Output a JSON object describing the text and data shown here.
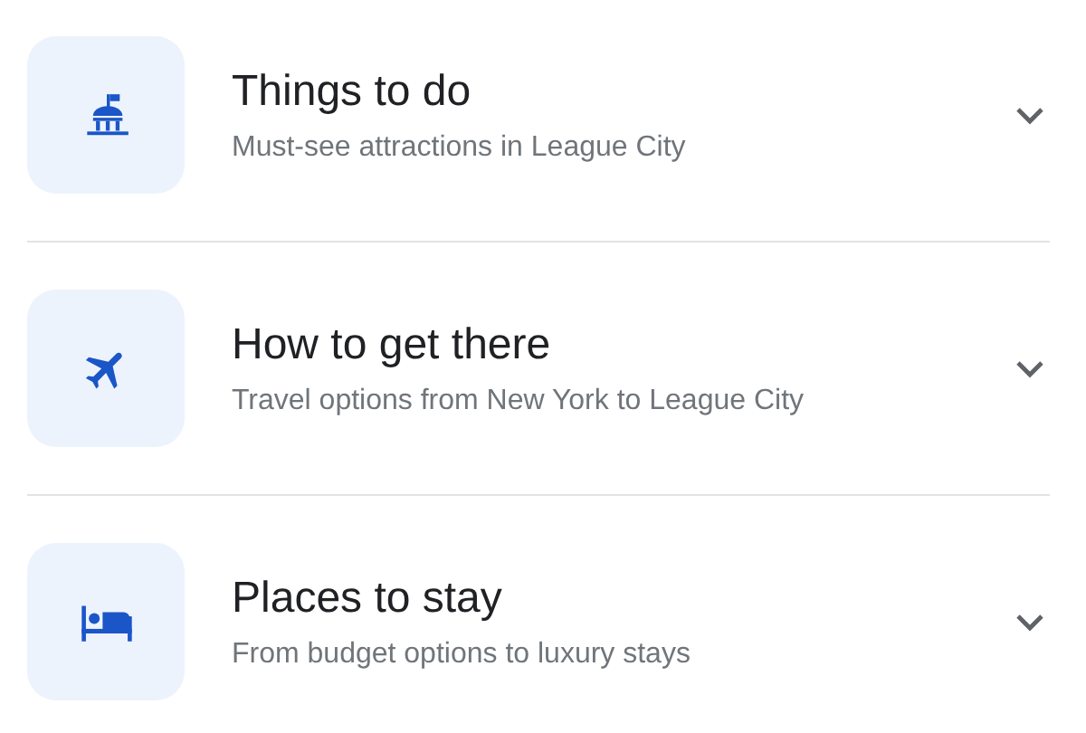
{
  "sections": [
    {
      "kind": "landmark",
      "title": "Things to do",
      "subtitle": "Must-see attractions in League City",
      "expanded": false
    },
    {
      "kind": "flight",
      "title": "How to get there",
      "subtitle": "Travel options from New York to League City",
      "expanded": false
    },
    {
      "kind": "hotel",
      "title": "Places to stay",
      "subtitle": "From budget options to luxury stays",
      "expanded": false
    }
  ]
}
